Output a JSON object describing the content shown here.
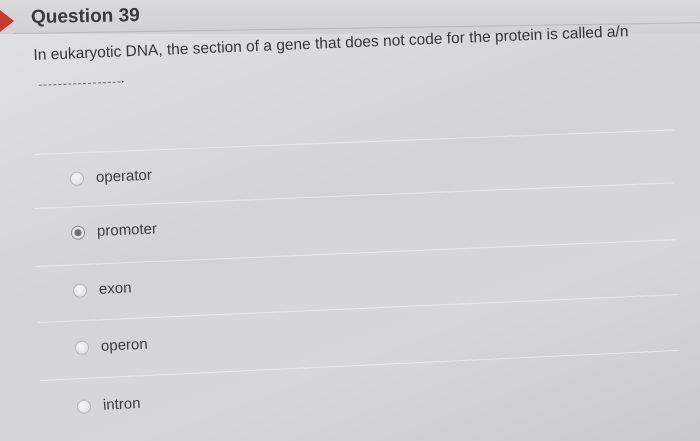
{
  "question": {
    "title": "Question 39",
    "text": "In eukaryotic DNA, the section of a gene that does not code for the protein is called a/n",
    "blank_suffix": "."
  },
  "options": [
    {
      "label": "operator",
      "selected": false
    },
    {
      "label": "promoter",
      "selected": true
    },
    {
      "label": "exon",
      "selected": false
    },
    {
      "label": "operon",
      "selected": false
    },
    {
      "label": "intron",
      "selected": false
    }
  ],
  "colors": {
    "flag": "#c63a2f",
    "text": "#37373a",
    "selected_radio": "#6f6f71"
  }
}
